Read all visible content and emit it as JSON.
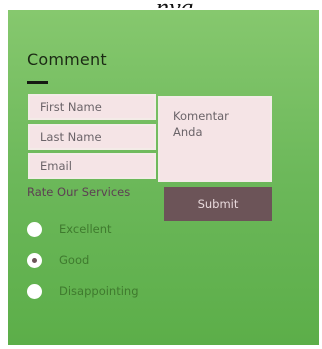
{
  "header_fragment": "nya.",
  "form": {
    "title": "Comment",
    "fields": {
      "first_name": "First Name",
      "last_name": "Last Name",
      "email": "Email"
    },
    "comment_placeholder": "Komentar\nAnda",
    "rate_label": "Rate Our Services",
    "submit_label": "Submit",
    "rating_options": [
      {
        "label": "Excellent",
        "selected": false
      },
      {
        "label": "Good",
        "selected": true
      },
      {
        "label": "Disappointing",
        "selected": false
      }
    ]
  },
  "colors": {
    "panel_top": "#86c86e",
    "panel_bottom": "#5cae49",
    "input_bg": "#f5e4e6",
    "button_bg": "#6c5458",
    "button_text": "#e8d9dc",
    "title_text": "#1b2a14",
    "rate_label_text": "#5d3f53",
    "option_text": "#3f7a2e"
  }
}
